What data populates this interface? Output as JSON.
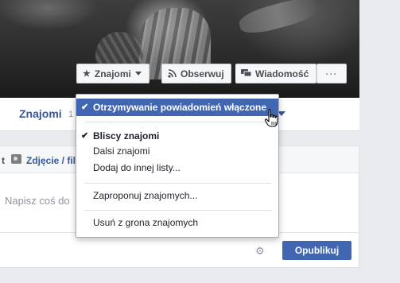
{
  "profile_buttons": {
    "friends_label": "Znajomi",
    "follow_label": "Obserwuj",
    "message_label": "Wiadomość",
    "more_label": "···"
  },
  "tabs": {
    "friends_label": "Znajomi",
    "friends_count": "1"
  },
  "composer": {
    "prefix": "t",
    "photo_label": "Zdjęcie / fil",
    "placeholder": "Napisz coś do",
    "publish_label": "Opublikuj"
  },
  "friends_menu": {
    "notifications_label": "Otrzymywanie powiadomień włączone",
    "close_friends_label": "Bliscy znajomi",
    "acquaintances_label": "Dalsi znajomi",
    "add_to_list_label": "Dodaj do innej listy...",
    "suggest_label": "Zaproponuj znajomych...",
    "unfriend_label": "Usuń z grona znajomych"
  },
  "icons": {
    "friends": "star-icon",
    "follow": "rss-icon",
    "message": "chat-icon",
    "settings": "gear-icon",
    "check": "check-icon"
  }
}
